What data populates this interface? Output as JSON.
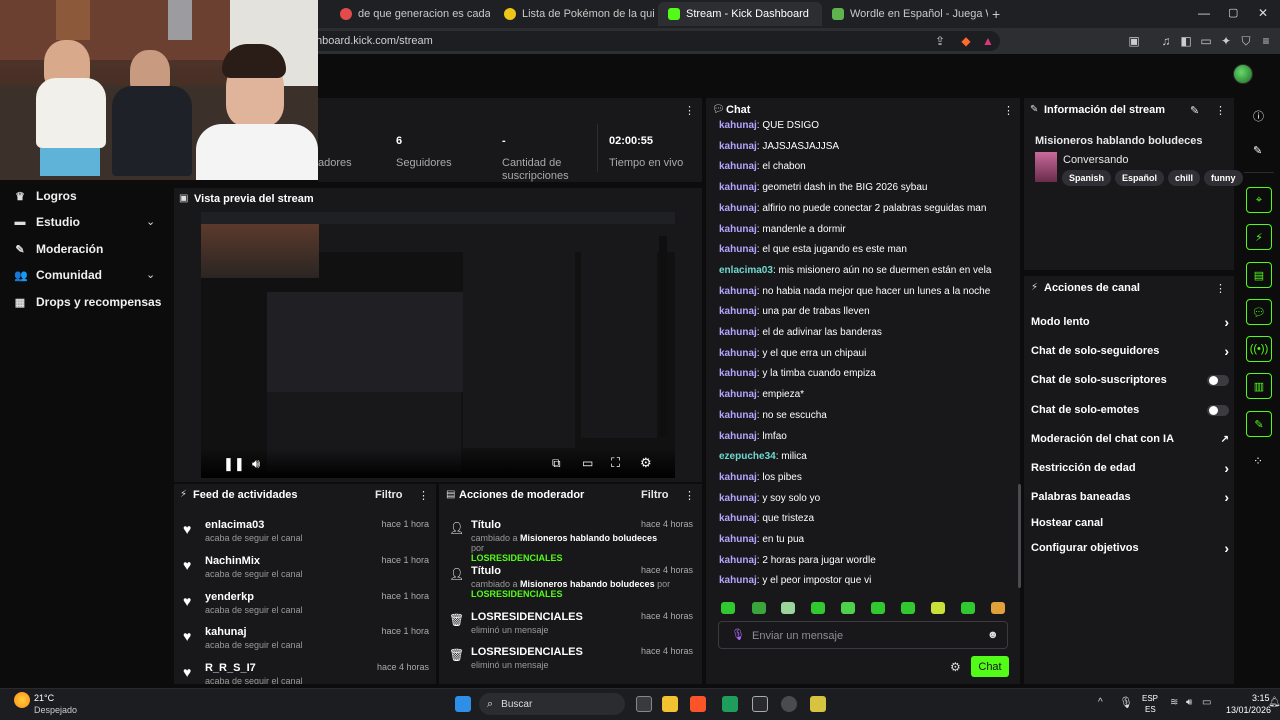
{
  "browser": {
    "tabs": [
      {
        "label": "de que generacion es cada evolucion",
        "favicon_color": "#e24b4b"
      },
      {
        "label": "Lista de Pokémon de la quinta gener",
        "favicon_color": "#f0c419"
      },
      {
        "label": "Stream - Kick Dashboard",
        "favicon_color": "#53fc18",
        "active": true
      },
      {
        "label": "Wordle en Español - Juega Wordle c",
        "favicon_color": "#5eb34e"
      }
    ],
    "url": "hboard.kick.com/stream",
    "close_glyph": "✕",
    "new_tab_glyph": "+"
  },
  "stats": {
    "col1_label": "adores",
    "followers_value": "6",
    "followers_label": "Seguidores",
    "subs_value": "-",
    "subs_label": "Cantidad de suscripciones",
    "live_value": "02:00:55",
    "live_label": "Tiempo en vivo"
  },
  "sidebar": {
    "items": [
      {
        "label": "Logros",
        "icon": "trophy-icon"
      },
      {
        "label": "Estudio",
        "icon": "studio-icon"
      },
      {
        "label": "Moderación",
        "icon": "wrench-icon"
      },
      {
        "label": "Comunidad",
        "icon": "people-icon"
      },
      {
        "label": "Drops y recompensas",
        "icon": "gift-icon"
      }
    ]
  },
  "preview": {
    "title": "Vista previa del stream"
  },
  "activity": {
    "title": "Feed de actividades",
    "filter": "Filtro",
    "items": [
      {
        "name": "enlacima03",
        "desc": "acaba de seguir el canal",
        "time": "hace 1 hora"
      },
      {
        "name": "NachinMix",
        "desc": "acaba de seguir el canal",
        "time": "hace 1 hora"
      },
      {
        "name": "yenderkp",
        "desc": "acaba de seguir el canal",
        "time": "hace 1 hora"
      },
      {
        "name": "kahunaj",
        "desc": "acaba de seguir el canal",
        "time": "hace 1 hora"
      },
      {
        "name": "R_R_S_I7",
        "desc": "acaba de seguir el canal",
        "time": "hace 4 horas"
      }
    ]
  },
  "mod_actions": {
    "title": "Acciones de moderador",
    "filter": "Filtro",
    "items": [
      {
        "title": "Título",
        "desc_prefix": "cambiado a",
        "desc_value": "Misioneros hablando boludeces",
        "desc_by": "por",
        "actor": "LOSRESIDENCIALES",
        "time": "hace 4 horas",
        "icon": "user-edit-icon"
      },
      {
        "title": "Título",
        "desc_prefix": "cambiado a",
        "desc_value": "Misioneros habando boludeces",
        "desc_by": "por",
        "actor": "LOSRESIDENCIALES",
        "time": "hace 4 horas",
        "icon": "user-edit-icon"
      },
      {
        "title": "LOSRESIDENCIALES",
        "desc_prefix": "eliminó un mensaje",
        "time": "hace 4 horas",
        "icon": "trash-icon"
      },
      {
        "title": "LOSRESIDENCIALES",
        "desc_prefix": "eliminó un mensaje",
        "time": "hace 4 horas",
        "icon": "trash-icon"
      }
    ]
  },
  "chat": {
    "title": "Chat",
    "messages": [
      {
        "user": "kahunaj",
        "text": "QUE DSIGO"
      },
      {
        "user": "kahunaj",
        "text": "JAJSJASJAJJSA"
      },
      {
        "user": "kahunaj",
        "text": "el chabon"
      },
      {
        "user": "kahunaj",
        "text": "geometri dash in the BIG 2026 sybau"
      },
      {
        "user": "kahunaj",
        "text": "alfirio no puede conectar 2 palabras seguidas man"
      },
      {
        "user": "kahunaj",
        "text": "mandenle a dormir"
      },
      {
        "user": "kahunaj",
        "text": "el que esta jugando es este man"
      },
      {
        "user": "enlacima03",
        "text": "mis misionero aún no se duermen están en vela"
      },
      {
        "user": "kahunaj",
        "text": "no habia nada mejor que hacer un lunes a la noche"
      },
      {
        "user": "kahunaj",
        "text": "una par de trabas lleven"
      },
      {
        "user": "kahunaj",
        "text": "el de adivinar las banderas"
      },
      {
        "user": "kahunaj",
        "text": "y el que erra un chipaui"
      },
      {
        "user": "kahunaj",
        "text": "y la timba cuando empiza"
      },
      {
        "user": "kahunaj",
        "text": "empieza*"
      },
      {
        "user": "kahunaj",
        "text": "no se escucha"
      },
      {
        "user": "kahunaj",
        "text": "lmfao"
      },
      {
        "user": "ezepuche34",
        "text": "milica"
      },
      {
        "user": "kahunaj",
        "text": "los pibes"
      },
      {
        "user": "kahunaj",
        "text": "y soy solo yo"
      },
      {
        "user": "kahunaj",
        "text": "que tristeza"
      },
      {
        "user": "kahunaj",
        "text": "en tu pua"
      },
      {
        "user": "kahunaj",
        "text": "2 horas para jugar wordle"
      },
      {
        "user": "kahunaj",
        "text": "y el peor impostor que vi"
      }
    ],
    "input_placeholder": "Enviar un mensaje",
    "send_label": "Chat"
  },
  "stream_info": {
    "title": "Información del stream",
    "stream_title": "Misioneros hablando boludeces",
    "category": "Conversando",
    "tags": [
      "Spanish",
      "Español",
      "chill",
      "funny"
    ]
  },
  "channel_actions": {
    "title": "Acciones de canal",
    "items": [
      {
        "label": "Modo lento",
        "control": "chevron"
      },
      {
        "label": "Chat de solo-seguidores",
        "control": "chevron"
      },
      {
        "label": "Chat de solo-suscriptores",
        "control": "toggle"
      },
      {
        "label": "Chat de solo-emotes",
        "control": "toggle"
      },
      {
        "label": "Moderación del chat con IA",
        "control": "external"
      },
      {
        "label": "Restricción de edad",
        "control": "chevron"
      },
      {
        "label": "Palabras baneadas",
        "control": "chevron"
      },
      {
        "label": "Hostear canal",
        "control": "none"
      },
      {
        "label": "Configurar objetivos",
        "control": "chevron"
      }
    ]
  },
  "taskbar": {
    "weather_temp": "21°C",
    "weather_desc": "Despejado",
    "search_label": "Buscar",
    "lang_top": "ESP",
    "lang_bottom": "ES",
    "time": "3:15",
    "date": "13/01/2026"
  },
  "colors": {
    "accent": "#53fc18",
    "chat_user": "#b6a4ff"
  }
}
